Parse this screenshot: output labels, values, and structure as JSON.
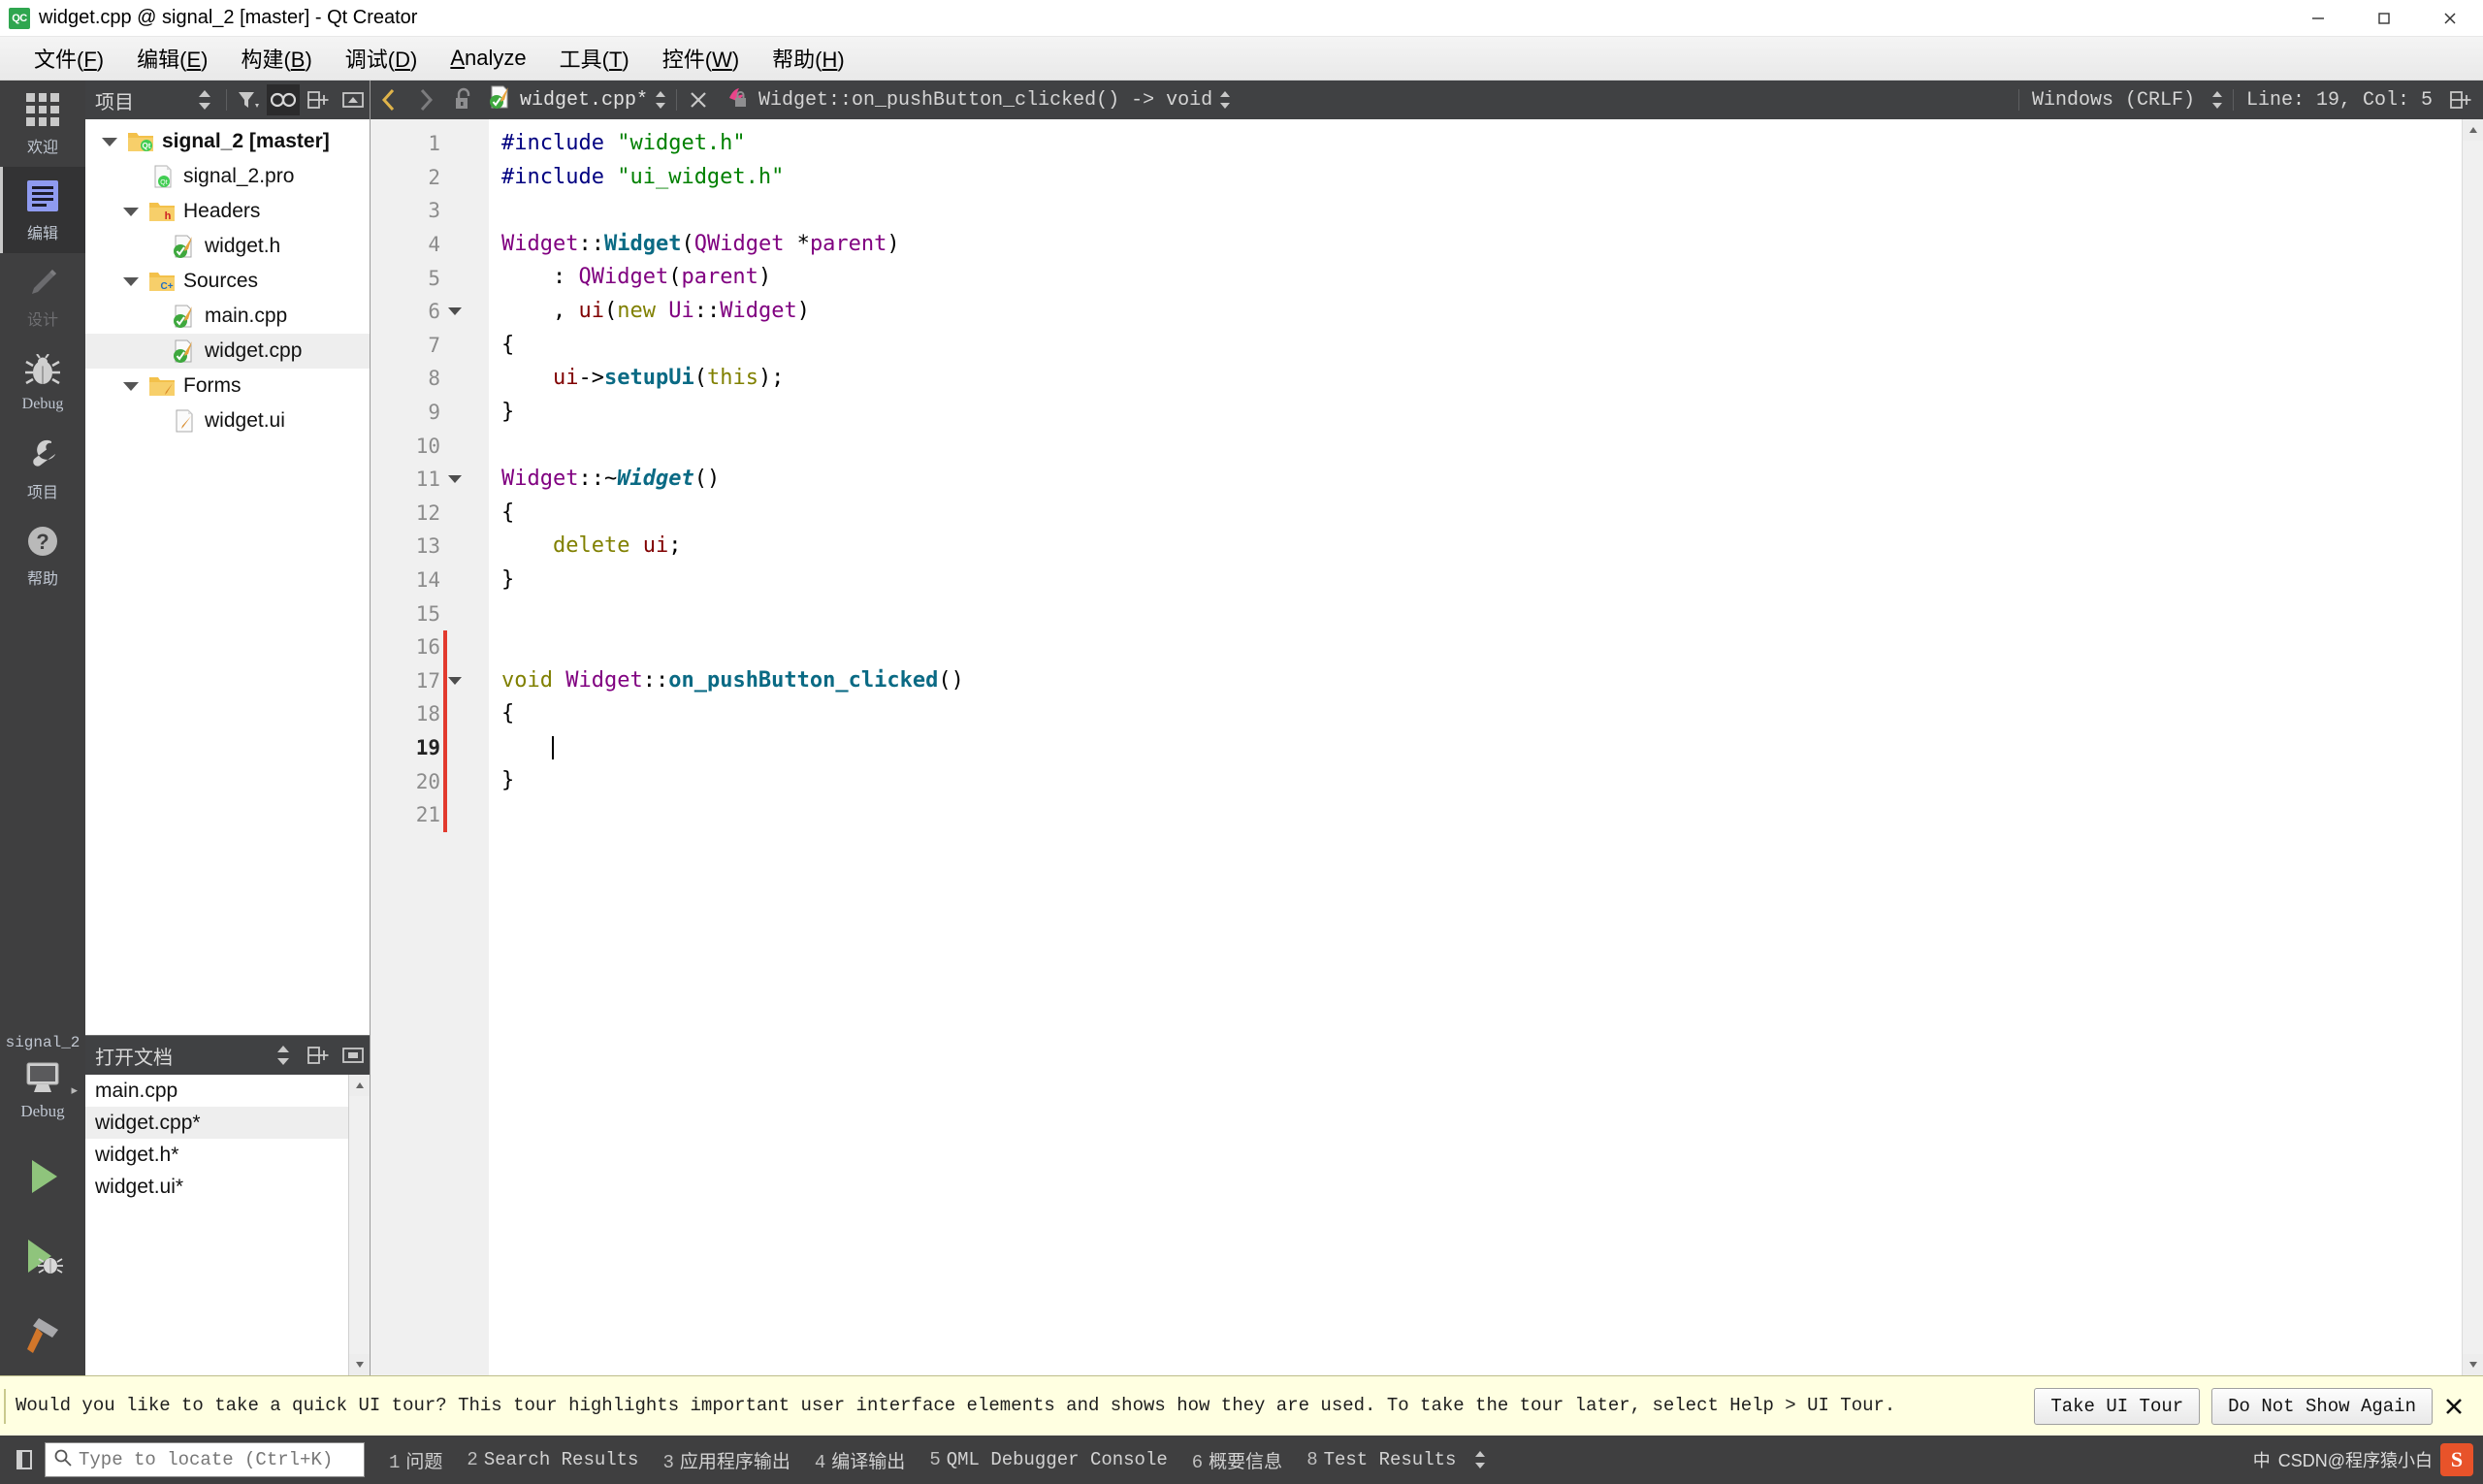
{
  "window": {
    "title": "widget.cpp @ signal_2 [master] - Qt Creator",
    "app_icon": "QC",
    "minimize": "–",
    "maximize": "□",
    "close": "✕"
  },
  "menubar": {
    "items": [
      {
        "label": "文件(F)",
        "plain": "文件",
        "mnemonic": "F"
      },
      {
        "label": "编辑(E)",
        "plain": "编辑",
        "mnemonic": "E"
      },
      {
        "label": "构建(B)",
        "plain": "构建",
        "mnemonic": "B"
      },
      {
        "label": "调试(D)",
        "plain": "调试",
        "mnemonic": "D"
      },
      {
        "label": "Analyze",
        "plain": "Analyze",
        "mnemonic": "A"
      },
      {
        "label": "工具(T)",
        "plain": "工具",
        "mnemonic": "T"
      },
      {
        "label": "控件(W)",
        "plain": "控件",
        "mnemonic": "W"
      },
      {
        "label": "帮助(H)",
        "plain": "帮助",
        "mnemonic": "H"
      }
    ]
  },
  "modebar": {
    "items": [
      {
        "label": "欢迎",
        "icon": "grid-icon",
        "state": "normal"
      },
      {
        "label": "编辑",
        "icon": "edit-icon",
        "state": "active"
      },
      {
        "label": "设计",
        "icon": "pencil-icon",
        "state": "disabled"
      },
      {
        "label": "Debug",
        "icon": "bug-icon",
        "state": "normal"
      },
      {
        "label": "项目",
        "icon": "wrench-icon",
        "state": "normal"
      },
      {
        "label": "帮助",
        "icon": "question-icon",
        "state": "normal"
      }
    ],
    "kit": {
      "project_name": "signal_2",
      "build_config": "Debug",
      "icon": "desktop-icon",
      "arrow": "▸"
    },
    "run_buttons": [
      {
        "name": "run-button",
        "icon": "play-icon"
      },
      {
        "name": "debug-button",
        "icon": "play-bug-icon"
      },
      {
        "name": "build-button",
        "icon": "hammer-icon"
      }
    ]
  },
  "project_dock": {
    "title": "项目",
    "tools": [
      {
        "name": "sync-updown-button",
        "icon": "updown-arrows-icon",
        "active": false
      },
      {
        "name": "filter-button",
        "icon": "filter-icon",
        "active": false
      },
      {
        "name": "sync-with-editor-button",
        "icon": "link-icon",
        "active": true
      },
      {
        "name": "split-button",
        "icon": "split-icon",
        "active": false
      },
      {
        "name": "collapse-button",
        "icon": "collapse-icon",
        "active": false
      }
    ],
    "tree": [
      {
        "label": "signal_2 [master]",
        "indent": 0,
        "icon": "qt-folder-icon",
        "expander": "down",
        "bold": true,
        "selected": false
      },
      {
        "label": "signal_2.pro",
        "indent": 1,
        "icon": "qt-pro-file-icon",
        "expander": "none",
        "bold": false,
        "selected": false
      },
      {
        "label": "Headers",
        "indent": 1,
        "icon": "headers-folder-icon",
        "expander": "down",
        "bold": false,
        "selected": false
      },
      {
        "label": "widget.h",
        "indent": 2,
        "icon": "cpp-file-icon",
        "expander": "none",
        "bold": false,
        "selected": false
      },
      {
        "label": "Sources",
        "indent": 1,
        "icon": "sources-folder-icon",
        "expander": "down",
        "bold": false,
        "selected": false
      },
      {
        "label": "main.cpp",
        "indent": 2,
        "icon": "cpp-file-icon",
        "expander": "none",
        "bold": false,
        "selected": false
      },
      {
        "label": "widget.cpp",
        "indent": 2,
        "icon": "cpp-file-icon",
        "expander": "none",
        "bold": false,
        "selected": true
      },
      {
        "label": "Forms",
        "indent": 1,
        "icon": "forms-folder-icon",
        "expander": "down",
        "bold": false,
        "selected": false
      },
      {
        "label": "widget.ui",
        "indent": 2,
        "icon": "ui-file-icon",
        "expander": "none",
        "bold": false,
        "selected": false
      }
    ]
  },
  "open_documents_dock": {
    "title": "打开文档",
    "tools": [
      {
        "name": "sync-updown-button",
        "icon": "updown-arrows-icon"
      },
      {
        "name": "split-button",
        "icon": "split-icon"
      },
      {
        "name": "close-dock-button",
        "icon": "collapse-icon"
      }
    ],
    "documents": [
      {
        "label": "main.cpp",
        "selected": false
      },
      {
        "label": "widget.cpp*",
        "selected": true
      },
      {
        "label": "widget.h*",
        "selected": false
      },
      {
        "label": "widget.ui*",
        "selected": false
      }
    ]
  },
  "editor_toolbar": {
    "back_icon": "chevron-left-icon",
    "forward_icon": "chevron-right-icon",
    "lock_icon": "unlocked-icon",
    "file_icon": "cpp-file-icon",
    "file_name": "widget.cpp*",
    "file_dropdown_icon": "updown-arrows-icon",
    "close_icon": "close-icon",
    "symbol_icon": "private-member-icon",
    "symbol_name": "Widget::on_pushButton_clicked() -> void",
    "symbol_dropdown_icon": "updown-arrows-icon",
    "line_ending": "Windows (CRLF)",
    "line_ending_dropdown_icon": "updown-arrows-icon",
    "cursor_position": "Line: 19, Col: 5",
    "split_icon": "split-icon"
  },
  "editor": {
    "current_line": 19,
    "change_bar": {
      "from_line": 16,
      "to_line": 21,
      "color": "#e23a2e"
    },
    "lines": [
      {
        "n": 1,
        "fold": false,
        "tokens": [
          {
            "t": "#include ",
            "c": "t-pre"
          },
          {
            "t": "\"widget.h\"",
            "c": "t-str"
          }
        ]
      },
      {
        "n": 2,
        "fold": false,
        "tokens": [
          {
            "t": "#include ",
            "c": "t-pre"
          },
          {
            "t": "\"ui_widget.h\"",
            "c": "t-str"
          }
        ]
      },
      {
        "n": 3,
        "fold": false,
        "tokens": []
      },
      {
        "n": 4,
        "fold": false,
        "tokens": [
          {
            "t": "Widget",
            "c": "t-cls"
          },
          {
            "t": "::",
            "c": "t-plain"
          },
          {
            "t": "Widget",
            "c": "t-fn"
          },
          {
            "t": "(",
            "c": "t-plain"
          },
          {
            "t": "QWidget",
            "c": "t-cls"
          },
          {
            "t": " *",
            "c": "t-plain"
          },
          {
            "t": "parent",
            "c": "t-cls"
          },
          {
            "t": ")",
            "c": "t-plain"
          }
        ]
      },
      {
        "n": 5,
        "fold": false,
        "tokens": [
          {
            "t": "    : ",
            "c": "t-plain"
          },
          {
            "t": "QWidget",
            "c": "t-cls"
          },
          {
            "t": "(",
            "c": "t-plain"
          },
          {
            "t": "parent",
            "c": "t-cls"
          },
          {
            "t": ")",
            "c": "t-plain"
          }
        ]
      },
      {
        "n": 6,
        "fold": true,
        "tokens": [
          {
            "t": "    , ",
            "c": "t-plain"
          },
          {
            "t": "ui",
            "c": "t-var"
          },
          {
            "t": "(",
            "c": "t-plain"
          },
          {
            "t": "new",
            "c": "t-kw"
          },
          {
            "t": " ",
            "c": "t-plain"
          },
          {
            "t": "Ui",
            "c": "t-cls"
          },
          {
            "t": "::",
            "c": "t-plain"
          },
          {
            "t": "Widget",
            "c": "t-cls"
          },
          {
            "t": ")",
            "c": "t-plain"
          }
        ]
      },
      {
        "n": 7,
        "fold": false,
        "tokens": [
          {
            "t": "{",
            "c": "t-plain"
          }
        ]
      },
      {
        "n": 8,
        "fold": false,
        "tokens": [
          {
            "t": "    ",
            "c": "t-plain"
          },
          {
            "t": "ui",
            "c": "t-var"
          },
          {
            "t": "->",
            "c": "t-plain"
          },
          {
            "t": "setupUi",
            "c": "t-fn"
          },
          {
            "t": "(",
            "c": "t-plain"
          },
          {
            "t": "this",
            "c": "t-kw"
          },
          {
            "t": ");",
            "c": "t-plain"
          }
        ]
      },
      {
        "n": 9,
        "fold": false,
        "tokens": [
          {
            "t": "}",
            "c": "t-plain"
          }
        ]
      },
      {
        "n": 10,
        "fold": false,
        "tokens": []
      },
      {
        "n": 11,
        "fold": true,
        "tokens": [
          {
            "t": "Widget",
            "c": "t-cls"
          },
          {
            "t": "::~",
            "c": "t-plain"
          },
          {
            "t": "Widget",
            "c": "t-fni"
          },
          {
            "t": "()",
            "c": "t-plain"
          }
        ]
      },
      {
        "n": 12,
        "fold": false,
        "tokens": [
          {
            "t": "{",
            "c": "t-plain"
          }
        ]
      },
      {
        "n": 13,
        "fold": false,
        "tokens": [
          {
            "t": "    ",
            "c": "t-plain"
          },
          {
            "t": "delete",
            "c": "t-kw"
          },
          {
            "t": " ",
            "c": "t-plain"
          },
          {
            "t": "ui",
            "c": "t-var"
          },
          {
            "t": ";",
            "c": "t-plain"
          }
        ]
      },
      {
        "n": 14,
        "fold": false,
        "tokens": [
          {
            "t": "}",
            "c": "t-plain"
          }
        ]
      },
      {
        "n": 15,
        "fold": false,
        "tokens": []
      },
      {
        "n": 16,
        "fold": false,
        "tokens": []
      },
      {
        "n": 17,
        "fold": true,
        "tokens": [
          {
            "t": "void",
            "c": "t-kw"
          },
          {
            "t": " ",
            "c": "t-plain"
          },
          {
            "t": "Widget",
            "c": "t-cls"
          },
          {
            "t": "::",
            "c": "t-plain"
          },
          {
            "t": "on_pushButton_clicked",
            "c": "t-fn"
          },
          {
            "t": "()",
            "c": "t-plain"
          }
        ]
      },
      {
        "n": 18,
        "fold": false,
        "tokens": [
          {
            "t": "{",
            "c": "t-plain"
          }
        ]
      },
      {
        "n": 19,
        "fold": false,
        "tokens": []
      },
      {
        "n": 20,
        "fold": false,
        "tokens": [
          {
            "t": "}",
            "c": "t-plain"
          }
        ]
      },
      {
        "n": 21,
        "fold": false,
        "tokens": []
      }
    ]
  },
  "notification": {
    "message": "Would you like to take a quick UI tour? This tour highlights important user interface elements and shows how they are used. To take the tour later, select Help > UI Tour.",
    "primary_button": "Take UI Tour",
    "secondary_button": "Do Not Show Again",
    "close_icon": "close-icon",
    "background": "#ffffe1"
  },
  "statusbar": {
    "toggle_sidebar_icon": "sidebar-toggle-icon",
    "locator_placeholder": "Type to locate (Ctrl+K)",
    "locator_icon": "search-icon",
    "panes": [
      {
        "key": "1",
        "label": "问题"
      },
      {
        "key": "2",
        "label": "Search Results"
      },
      {
        "key": "3",
        "label": "应用程序输出"
      },
      {
        "key": "4",
        "label": "编译输出"
      },
      {
        "key": "5",
        "label": "QML Debugger Console"
      },
      {
        "key": "6",
        "label": "概要信息"
      },
      {
        "key": "8",
        "label": "Test Results"
      }
    ],
    "more_icon": "updown-arrows-icon",
    "tray": {
      "sogou_icon": "S",
      "ime_label": "中",
      "watermark": "CSDN@程序猿小白"
    }
  }
}
